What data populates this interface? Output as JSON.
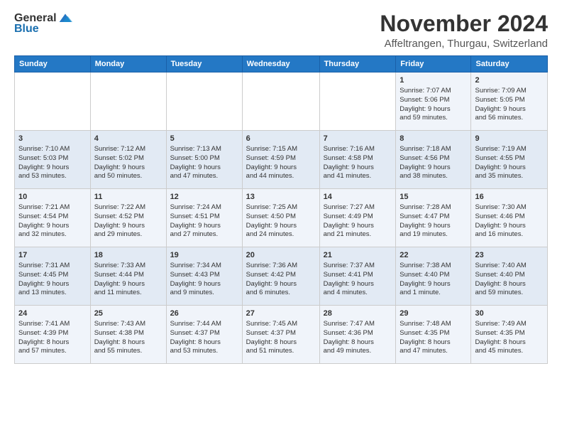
{
  "header": {
    "logo_general": "General",
    "logo_blue": "Blue",
    "month": "November 2024",
    "location": "Affeltrangen, Thurgau, Switzerland"
  },
  "weekdays": [
    "Sunday",
    "Monday",
    "Tuesday",
    "Wednesday",
    "Thursday",
    "Friday",
    "Saturday"
  ],
  "weeks": [
    [
      {
        "day": "",
        "info": ""
      },
      {
        "day": "",
        "info": ""
      },
      {
        "day": "",
        "info": ""
      },
      {
        "day": "",
        "info": ""
      },
      {
        "day": "",
        "info": ""
      },
      {
        "day": "1",
        "info": "Sunrise: 7:07 AM\nSunset: 5:06 PM\nDaylight: 9 hours\nand 59 minutes."
      },
      {
        "day": "2",
        "info": "Sunrise: 7:09 AM\nSunset: 5:05 PM\nDaylight: 9 hours\nand 56 minutes."
      }
    ],
    [
      {
        "day": "3",
        "info": "Sunrise: 7:10 AM\nSunset: 5:03 PM\nDaylight: 9 hours\nand 53 minutes."
      },
      {
        "day": "4",
        "info": "Sunrise: 7:12 AM\nSunset: 5:02 PM\nDaylight: 9 hours\nand 50 minutes."
      },
      {
        "day": "5",
        "info": "Sunrise: 7:13 AM\nSunset: 5:00 PM\nDaylight: 9 hours\nand 47 minutes."
      },
      {
        "day": "6",
        "info": "Sunrise: 7:15 AM\nSunset: 4:59 PM\nDaylight: 9 hours\nand 44 minutes."
      },
      {
        "day": "7",
        "info": "Sunrise: 7:16 AM\nSunset: 4:58 PM\nDaylight: 9 hours\nand 41 minutes."
      },
      {
        "day": "8",
        "info": "Sunrise: 7:18 AM\nSunset: 4:56 PM\nDaylight: 9 hours\nand 38 minutes."
      },
      {
        "day": "9",
        "info": "Sunrise: 7:19 AM\nSunset: 4:55 PM\nDaylight: 9 hours\nand 35 minutes."
      }
    ],
    [
      {
        "day": "10",
        "info": "Sunrise: 7:21 AM\nSunset: 4:54 PM\nDaylight: 9 hours\nand 32 minutes."
      },
      {
        "day": "11",
        "info": "Sunrise: 7:22 AM\nSunset: 4:52 PM\nDaylight: 9 hours\nand 29 minutes."
      },
      {
        "day": "12",
        "info": "Sunrise: 7:24 AM\nSunset: 4:51 PM\nDaylight: 9 hours\nand 27 minutes."
      },
      {
        "day": "13",
        "info": "Sunrise: 7:25 AM\nSunset: 4:50 PM\nDaylight: 9 hours\nand 24 minutes."
      },
      {
        "day": "14",
        "info": "Sunrise: 7:27 AM\nSunset: 4:49 PM\nDaylight: 9 hours\nand 21 minutes."
      },
      {
        "day": "15",
        "info": "Sunrise: 7:28 AM\nSunset: 4:47 PM\nDaylight: 9 hours\nand 19 minutes."
      },
      {
        "day": "16",
        "info": "Sunrise: 7:30 AM\nSunset: 4:46 PM\nDaylight: 9 hours\nand 16 minutes."
      }
    ],
    [
      {
        "day": "17",
        "info": "Sunrise: 7:31 AM\nSunset: 4:45 PM\nDaylight: 9 hours\nand 13 minutes."
      },
      {
        "day": "18",
        "info": "Sunrise: 7:33 AM\nSunset: 4:44 PM\nDaylight: 9 hours\nand 11 minutes."
      },
      {
        "day": "19",
        "info": "Sunrise: 7:34 AM\nSunset: 4:43 PM\nDaylight: 9 hours\nand 9 minutes."
      },
      {
        "day": "20",
        "info": "Sunrise: 7:36 AM\nSunset: 4:42 PM\nDaylight: 9 hours\nand 6 minutes."
      },
      {
        "day": "21",
        "info": "Sunrise: 7:37 AM\nSunset: 4:41 PM\nDaylight: 9 hours\nand 4 minutes."
      },
      {
        "day": "22",
        "info": "Sunrise: 7:38 AM\nSunset: 4:40 PM\nDaylight: 9 hours\nand 1 minute."
      },
      {
        "day": "23",
        "info": "Sunrise: 7:40 AM\nSunset: 4:40 PM\nDaylight: 8 hours\nand 59 minutes."
      }
    ],
    [
      {
        "day": "24",
        "info": "Sunrise: 7:41 AM\nSunset: 4:39 PM\nDaylight: 8 hours\nand 57 minutes."
      },
      {
        "day": "25",
        "info": "Sunrise: 7:43 AM\nSunset: 4:38 PM\nDaylight: 8 hours\nand 55 minutes."
      },
      {
        "day": "26",
        "info": "Sunrise: 7:44 AM\nSunset: 4:37 PM\nDaylight: 8 hours\nand 53 minutes."
      },
      {
        "day": "27",
        "info": "Sunrise: 7:45 AM\nSunset: 4:37 PM\nDaylight: 8 hours\nand 51 minutes."
      },
      {
        "day": "28",
        "info": "Sunrise: 7:47 AM\nSunset: 4:36 PM\nDaylight: 8 hours\nand 49 minutes."
      },
      {
        "day": "29",
        "info": "Sunrise: 7:48 AM\nSunset: 4:35 PM\nDaylight: 8 hours\nand 47 minutes."
      },
      {
        "day": "30",
        "info": "Sunrise: 7:49 AM\nSunset: 4:35 PM\nDaylight: 8 hours\nand 45 minutes."
      }
    ]
  ]
}
